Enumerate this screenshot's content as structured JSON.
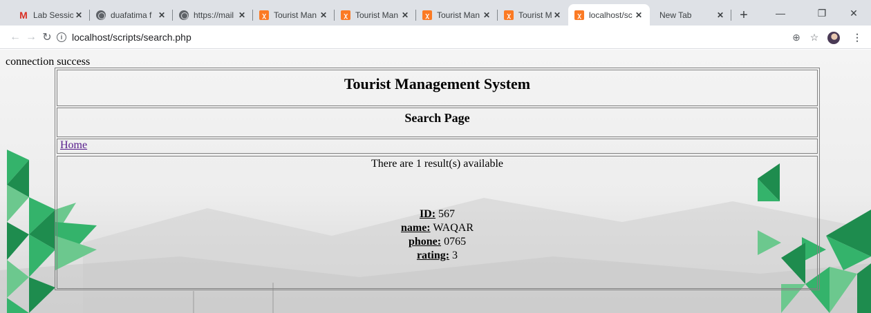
{
  "browser": {
    "tabs": [
      {
        "title": "Lab Session",
        "icon": "gmail-icon"
      },
      {
        "title": "duafatima f",
        "icon": "globe-icon"
      },
      {
        "title": "https://mail",
        "icon": "globe-icon"
      },
      {
        "title": "Tourist Man",
        "icon": "xampp-icon"
      },
      {
        "title": "Tourist Man",
        "icon": "xampp-icon"
      },
      {
        "title": "Tourist Man",
        "icon": "xampp-icon"
      },
      {
        "title": "Tourist Man",
        "icon": "xampp-icon"
      },
      {
        "title": "localhost/sc",
        "icon": "xampp-icon",
        "active": true
      },
      {
        "title": "New Tab",
        "icon": ""
      }
    ],
    "address": "localhost/scripts/search.php"
  },
  "page": {
    "connection_message": "connection success",
    "title": "Tourist Management System",
    "subtitle": "Search Page",
    "nav_home": "Home",
    "result_count": "There are 1 result(s) available",
    "record": {
      "id_label": "ID:",
      "id": "567",
      "name_label": "name:",
      "name": "WAQAR",
      "phone_label": "phone:",
      "phone": "0765",
      "rating_label": "rating:",
      "rating": "3"
    }
  },
  "colors": {
    "chrome_frame": "#dee1e6",
    "link_visited": "#551a8b",
    "decor_green_dark": "#1e8c4e",
    "decor_green_mid": "#34b36b",
    "decor_green_light": "#6cc88e"
  }
}
